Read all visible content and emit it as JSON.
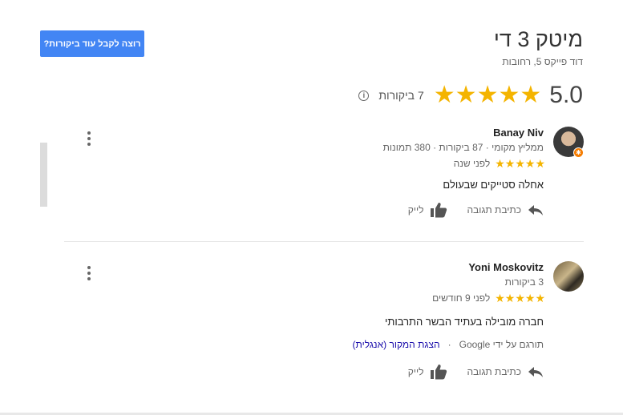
{
  "cta_button": {
    "label": "רוצה לקבל עוד ביקורות?"
  },
  "business": {
    "title": "מיטק 3 די",
    "address": "דוד פייקס 5, רחובות"
  },
  "rating": {
    "value": "5.0",
    "stars": 5,
    "star_color": "#f4b400",
    "reviews_count": "7 ביקורות",
    "info_icon": "i"
  },
  "reviews": [
    {
      "name": "Banay Niv",
      "meta": "ממליץ מקומי · 87 ביקורות · 380 תמונות",
      "time": "לפני שנה",
      "stars": 5,
      "text": "אחלה סטייקים שבעולם",
      "reply_label": "כתיבת תגובה",
      "like_label": "לייק",
      "local_guide_badge": "✱"
    },
    {
      "name": "Yoni Moskovitz",
      "meta": "3 ביקורות",
      "time": "לפני 9 חודשים",
      "stars": 5,
      "text": "חברה מובילה בעתיד הבשר התרבותי",
      "translated_note": "תורגם על ידי Google",
      "separator": "·",
      "original_link": "הצגת המקור (אנגלית)",
      "reply_label": "כתיבת תגובה",
      "like_label": "לייק"
    }
  ],
  "colors": {
    "accent_button": "#4285f4",
    "link": "#1a0dab"
  }
}
